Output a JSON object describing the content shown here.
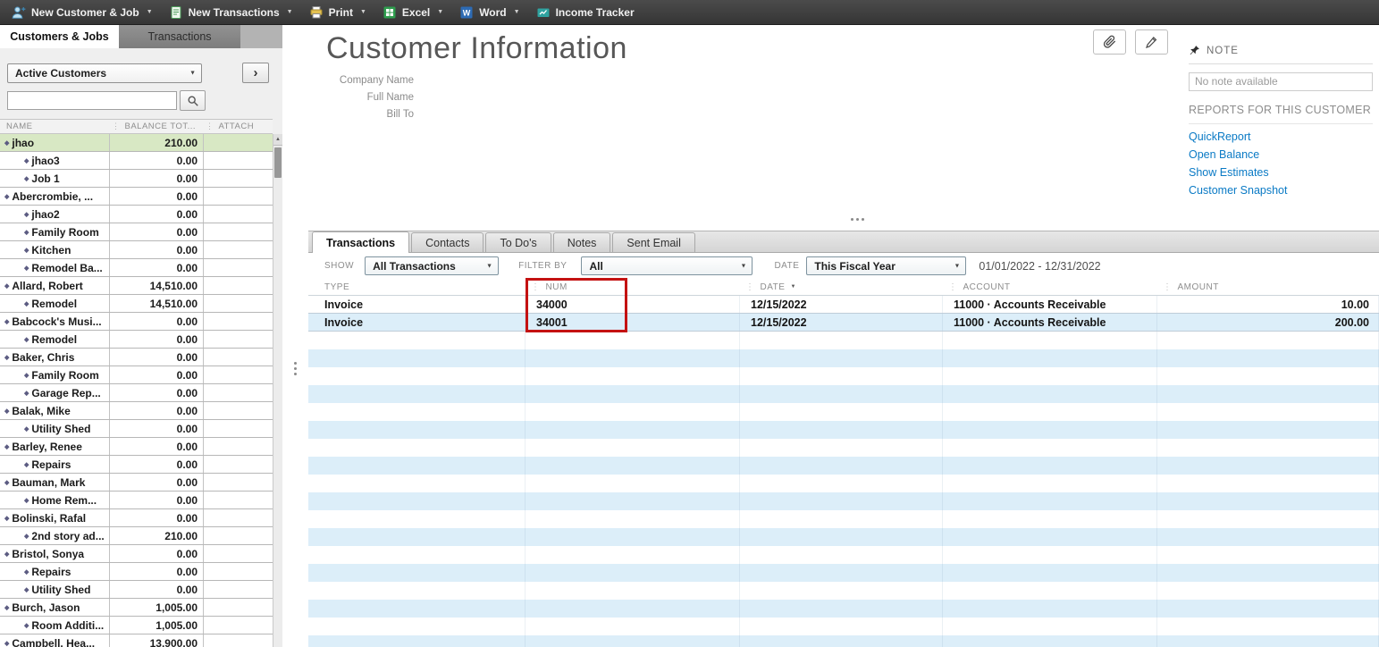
{
  "toolbar": {
    "items": [
      {
        "id": "new-customer",
        "label": "New Customer & Job",
        "icon": "new-customer-icon",
        "dropdown": true
      },
      {
        "id": "new-transactions",
        "label": "New Transactions",
        "icon": "new-transactions-icon",
        "dropdown": true
      },
      {
        "id": "print",
        "label": "Print",
        "icon": "print-icon",
        "dropdown": true
      },
      {
        "id": "excel",
        "label": "Excel",
        "icon": "excel-icon",
        "dropdown": true
      },
      {
        "id": "word",
        "label": "Word",
        "icon": "word-icon",
        "dropdown": true
      },
      {
        "id": "income-tracker",
        "label": "Income Tracker",
        "icon": "income-tracker-icon",
        "dropdown": false
      }
    ]
  },
  "sidebar": {
    "tabs": [
      {
        "label": "Customers & Jobs",
        "active": true
      },
      {
        "label": "Transactions",
        "active": false
      }
    ],
    "filter_value": "Active Customers",
    "search_placeholder": "",
    "columns": [
      "NAME",
      "BALANCE TOT...",
      "ATTACH"
    ],
    "rows": [
      {
        "name": "jhao",
        "balance": "210.00",
        "indent": 0,
        "selected": true
      },
      {
        "name": "jhao3",
        "balance": "0.00",
        "indent": 1
      },
      {
        "name": "Job 1",
        "balance": "0.00",
        "indent": 1
      },
      {
        "name": "Abercrombie, ...",
        "balance": "0.00",
        "indent": 0
      },
      {
        "name": "jhao2",
        "balance": "0.00",
        "indent": 1
      },
      {
        "name": "Family Room",
        "balance": "0.00",
        "indent": 1
      },
      {
        "name": "Kitchen",
        "balance": "0.00",
        "indent": 1
      },
      {
        "name": "Remodel Ba...",
        "balance": "0.00",
        "indent": 1
      },
      {
        "name": "Allard, Robert",
        "balance": "14,510.00",
        "indent": 0
      },
      {
        "name": "Remodel",
        "balance": "14,510.00",
        "indent": 1
      },
      {
        "name": "Babcock's Musi...",
        "balance": "0.00",
        "indent": 0
      },
      {
        "name": "Remodel",
        "balance": "0.00",
        "indent": 1
      },
      {
        "name": "Baker, Chris",
        "balance": "0.00",
        "indent": 0
      },
      {
        "name": "Family Room",
        "balance": "0.00",
        "indent": 1
      },
      {
        "name": "Garage Rep...",
        "balance": "0.00",
        "indent": 1
      },
      {
        "name": "Balak, Mike",
        "balance": "0.00",
        "indent": 0
      },
      {
        "name": "Utility Shed",
        "balance": "0.00",
        "indent": 1
      },
      {
        "name": "Barley, Renee",
        "balance": "0.00",
        "indent": 0
      },
      {
        "name": "Repairs",
        "balance": "0.00",
        "indent": 1
      },
      {
        "name": "Bauman, Mark",
        "balance": "0.00",
        "indent": 0
      },
      {
        "name": "Home Rem...",
        "balance": "0.00",
        "indent": 1
      },
      {
        "name": "Bolinski, Rafal",
        "balance": "0.00",
        "indent": 0
      },
      {
        "name": "2nd story ad...",
        "balance": "210.00",
        "indent": 1
      },
      {
        "name": "Bristol, Sonya",
        "balance": "0.00",
        "indent": 0
      },
      {
        "name": "Repairs",
        "balance": "0.00",
        "indent": 1
      },
      {
        "name": "Utility Shed",
        "balance": "0.00",
        "indent": 1
      },
      {
        "name": "Burch, Jason",
        "balance": "1,005.00",
        "indent": 0
      },
      {
        "name": "Room Additi...",
        "balance": "1,005.00",
        "indent": 1
      },
      {
        "name": "Campbell, Hea...",
        "balance": "13,900.00",
        "indent": 0
      }
    ]
  },
  "main": {
    "title": "Customer Information",
    "field_labels": [
      "Company Name",
      "Full Name",
      "Bill To"
    ]
  },
  "note_panel": {
    "title": "NOTE",
    "note_text": "No note available",
    "reports_title": "REPORTS FOR THIS CUSTOMER",
    "links": [
      "QuickReport",
      "Open Balance",
      "Show Estimates",
      "Customer Snapshot"
    ]
  },
  "transactions_panel": {
    "tabs": [
      "Transactions",
      "Contacts",
      "To Do's",
      "Notes",
      "Sent Email"
    ],
    "active_tab": "Transactions",
    "filters": {
      "show_label": "SHOW",
      "show_value": "All Transactions",
      "filter_label": "FILTER BY",
      "filter_value": "All",
      "date_label": "DATE",
      "date_value": "This Fiscal Year",
      "date_range": "01/01/2022 - 12/31/2022"
    },
    "columns": [
      "TYPE",
      "NUM",
      "DATE",
      "ACCOUNT",
      "AMOUNT"
    ],
    "rows": [
      {
        "type": "Invoice",
        "num": "34000",
        "date": "12/15/2022",
        "account": "11000 · Accounts Receivable",
        "amount": "10.00"
      },
      {
        "type": "Invoice",
        "num": "34001",
        "date": "12/15/2022",
        "account": "11000 · Accounts Receivable",
        "amount": "200.00"
      }
    ]
  },
  "annotation": {
    "type": "highlight-box",
    "target": "num-column",
    "color": "#c41212"
  }
}
